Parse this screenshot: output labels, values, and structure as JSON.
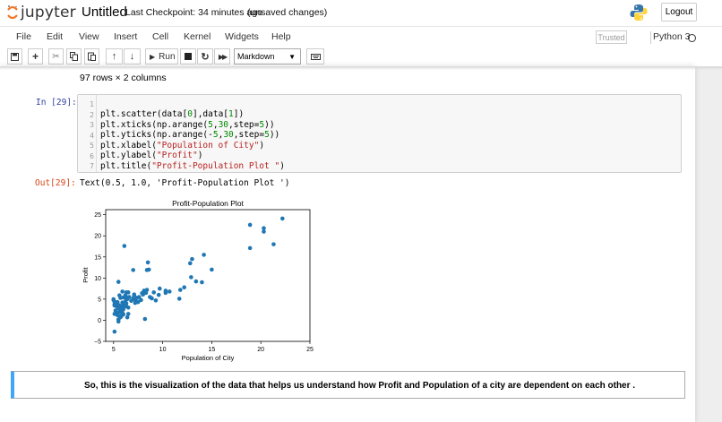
{
  "header": {
    "brand": "jupyter",
    "notebook_name": "Untitled",
    "checkpoint": "Last Checkpoint: 34 minutes ago",
    "status": "(unsaved changes)",
    "logout_label": "Logout"
  },
  "menu": [
    "File",
    "Edit",
    "View",
    "Insert",
    "Cell",
    "Kernel",
    "Widgets",
    "Help"
  ],
  "trusted_label": "Trusted",
  "kernel_name": "Python 3",
  "toolbar": {
    "run_label": "Run",
    "cell_type": "Markdown"
  },
  "prev_output": "97 rows × 2 columns",
  "code_cell": {
    "prompt": "In [29]:",
    "line_numbers": [
      "1",
      "2",
      "3",
      "4",
      "5",
      "6",
      "7"
    ],
    "lines": [
      "",
      "plt.scatter(data[0],data[1])",
      "plt.xticks(np.arange(5,30,step=5))",
      "plt.yticks(np.arange(-5,30,step=5))",
      "plt.xlabel(\"Population of City\")",
      "plt.ylabel(\"Profit\")",
      "plt.title(\"Profit-Population Plot \")"
    ]
  },
  "output": {
    "prompt": "Out[29]:",
    "text": "Text(0.5, 1.0, 'Profit-Population Plot ')"
  },
  "chart_data": {
    "type": "scatter",
    "title": "Profit-Population Plot",
    "xlabel": "Population of City",
    "ylabel": "Profit",
    "xlim": [
      4.2,
      25
    ],
    "ylim": [
      -5,
      26.2
    ],
    "xticks": [
      5,
      10,
      15,
      20,
      25
    ],
    "yticks": [
      -5,
      0,
      5,
      10,
      15,
      20,
      25
    ],
    "grid": false,
    "color": "#1f77b4",
    "points": [
      [
        6.1,
        17.6
      ],
      [
        5.5,
        9.1
      ],
      [
        8.5,
        13.7
      ],
      [
        7.0,
        11.9
      ],
      [
        5.9,
        6.8
      ],
      [
        8.4,
        11.9
      ],
      [
        7.5,
        4.3
      ],
      [
        8.6,
        12.0
      ],
      [
        6.5,
        6.6
      ],
      [
        5.1,
        3.8
      ],
      [
        5.7,
        3.3
      ],
      [
        14.2,
        15.5
      ],
      [
        5.7,
        3.1
      ],
      [
        8.4,
        7.2
      ],
      [
        6.4,
        0.7
      ],
      [
        5.1,
        3.5
      ],
      [
        5.7,
        5.3
      ],
      [
        10.3,
        7.0
      ],
      [
        6.0,
        5.4
      ],
      [
        5.5,
        0.2
      ],
      [
        5.0,
        5.0
      ],
      [
        5.1,
        1.5
      ],
      [
        5.3,
        1.8
      ],
      [
        6.4,
        5.0
      ],
      [
        5.7,
        0.7
      ],
      [
        7.1,
        6.1
      ],
      [
        5.6,
        1.9
      ],
      [
        5.4,
        4.3
      ],
      [
        6.4,
        5.4
      ],
      [
        6.0,
        3.0
      ],
      [
        12.8,
        13.5
      ],
      [
        6.3,
        6.6
      ],
      [
        5.5,
        -0.3
      ],
      [
        5.4,
        4.0
      ],
      [
        5.2,
        3.8
      ],
      [
        6.0,
        1.4
      ],
      [
        5.7,
        2.4
      ],
      [
        8.3,
        6.5
      ],
      [
        7.6,
        5.5
      ],
      [
        6.2,
        5.9
      ],
      [
        8.9,
        5.2
      ],
      [
        5.0,
        4.8
      ],
      [
        5.8,
        1.0
      ],
      [
        8.0,
        6.1
      ],
      [
        7.2,
        4.8
      ],
      [
        6.2,
        4.4
      ],
      [
        5.2,
        2.3
      ],
      [
        6.5,
        1.5
      ],
      [
        5.1,
        -2.7
      ],
      [
        7.4,
        5.3
      ],
      [
        9.3,
        4.7
      ],
      [
        7.1,
        5.9
      ],
      [
        6.5,
        3.0
      ],
      [
        10.3,
        6.5
      ],
      [
        13.4,
        9.2
      ],
      [
        10.7,
        6.8
      ],
      [
        11.8,
        7.2
      ],
      [
        8.2,
        0.3
      ],
      [
        11.7,
        5.1
      ],
      [
        5.7,
        0.9
      ],
      [
        6.3,
        4.0
      ],
      [
        7.8,
        4.8
      ],
      [
        9.6,
        6.0
      ],
      [
        8.7,
        5.5
      ],
      [
        5.9,
        4.2
      ],
      [
        5.6,
        3.5
      ],
      [
        6.8,
        4.6
      ],
      [
        7.0,
        5.2
      ],
      [
        5.2,
        1.5
      ],
      [
        5.5,
        2.8
      ],
      [
        12.2,
        7.8
      ],
      [
        15.0,
        12.0
      ],
      [
        13.0,
        14.5
      ],
      [
        12.9,
        10.2
      ],
      [
        14.0,
        9.0
      ],
      [
        18.9,
        22.6
      ],
      [
        20.3,
        21.8
      ],
      [
        20.3,
        21.0
      ],
      [
        22.2,
        24.1
      ],
      [
        18.9,
        17.1
      ],
      [
        21.3,
        18.0
      ],
      [
        7.2,
        4.1
      ],
      [
        6.3,
        5.0
      ],
      [
        6.0,
        3.7
      ],
      [
        5.9,
        1.8
      ],
      [
        5.3,
        3.3
      ],
      [
        5.8,
        2.2
      ],
      [
        6.0,
        2.6
      ],
      [
        7.9,
        6.4
      ],
      [
        8.1,
        7.0
      ],
      [
        9.1,
        6.6
      ],
      [
        6.6,
        5.5
      ],
      [
        5.1,
        4.4
      ],
      [
        5.6,
        5.9
      ],
      [
        9.7,
        7.5
      ],
      [
        6.3,
        3.3
      ],
      [
        5.4,
        1.2
      ]
    ]
  },
  "markdown_cell": {
    "text": "So, this is the visualization of the data that helps us understand how Profit and Population of a city are dependent on each other ."
  }
}
